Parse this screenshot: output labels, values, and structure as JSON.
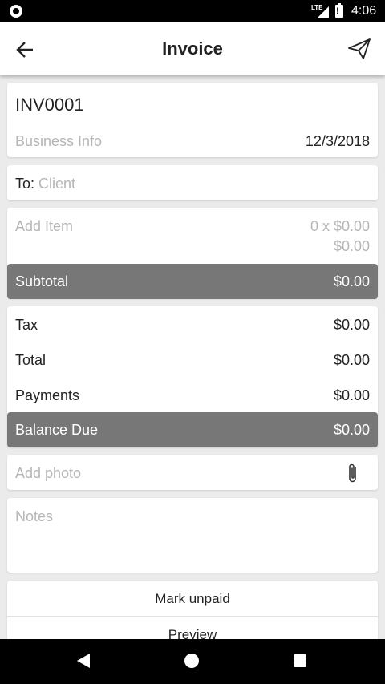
{
  "status_bar": {
    "network": "LTE",
    "battery_text": "!",
    "time": "4:06"
  },
  "app_bar": {
    "title": "Invoice",
    "back_icon": "arrow-left-icon",
    "send_icon": "send-icon"
  },
  "invoice": {
    "number": "INV0001",
    "business_info_placeholder": "Business Info",
    "date": "12/3/2018"
  },
  "client": {
    "label": "To:",
    "placeholder": "Client"
  },
  "item": {
    "placeholder": "Add Item",
    "quantity_price": "0 x $0.00",
    "amount": "$0.00"
  },
  "subtotal": {
    "label": "Subtotal",
    "value": "$0.00"
  },
  "totals": {
    "tax_label": "Tax",
    "tax_value": "$0.00",
    "total_label": "Total",
    "total_value": "$0.00",
    "payments_label": "Payments",
    "payments_value": "$0.00"
  },
  "balance": {
    "label": "Balance Due",
    "value": "$0.00"
  },
  "photo": {
    "placeholder": "Add photo",
    "icon": "paperclip-icon"
  },
  "notes": {
    "placeholder": "Notes"
  },
  "actions": {
    "mark_unpaid": "Mark unpaid",
    "preview": "Preview"
  },
  "colors": {
    "bar_gray": "#777777",
    "muted_text": "#b6b6b6",
    "background": "#ebebeb"
  }
}
